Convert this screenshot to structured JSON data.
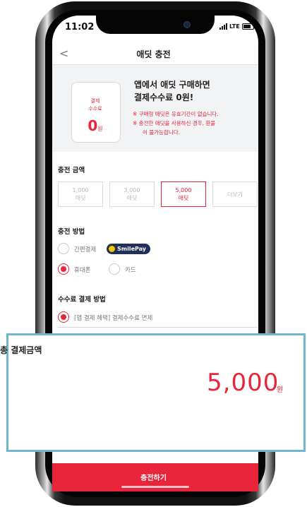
{
  "status_bar": {
    "time": "11:02",
    "network": "LTE"
  },
  "header": {
    "back_icon": "chevron-left-icon",
    "title": "애딧 충전"
  },
  "promo": {
    "card_label_line1": "결제",
    "card_label_line2": "수수료",
    "card_zero": "0",
    "card_unit": "원",
    "headline_line1": "앱에서 애딧 구매하면",
    "headline_line2": "결제수수료 0원!",
    "note_line1": "※ 구매형 애딧은 유효기간이 없습니다.",
    "note_line2": "※ 충전한 애딧을 사용하신 경우, 환불",
    "note_line3": "이 불가능합니다."
  },
  "amount": {
    "title": "충전 금액",
    "options": [
      {
        "value": "1,000",
        "unit": "애딧"
      },
      {
        "value": "3,000",
        "unit": "애딧"
      },
      {
        "value": "5,000",
        "unit": "애딧"
      }
    ],
    "more": "더보기",
    "selected_index": 2
  },
  "charge_method": {
    "title": "충전 방법",
    "simple_pay": "간편결제",
    "smile_pay": "SmilePay",
    "phone": "휴대폰",
    "card": "카드",
    "selected": "휴대폰"
  },
  "fee_method": {
    "title": "수수료 결제 방법",
    "option": "[앱 결제 혜택] 결제수수료 면제"
  },
  "total": {
    "label": "총 결제금액",
    "value": "5,000",
    "unit": "원"
  },
  "charge_button": {
    "label": "충전하기"
  },
  "colors": {
    "accent": "#e8253a",
    "highlight_border": "#6fb8cf",
    "smilepay_bg": "#20305a"
  }
}
